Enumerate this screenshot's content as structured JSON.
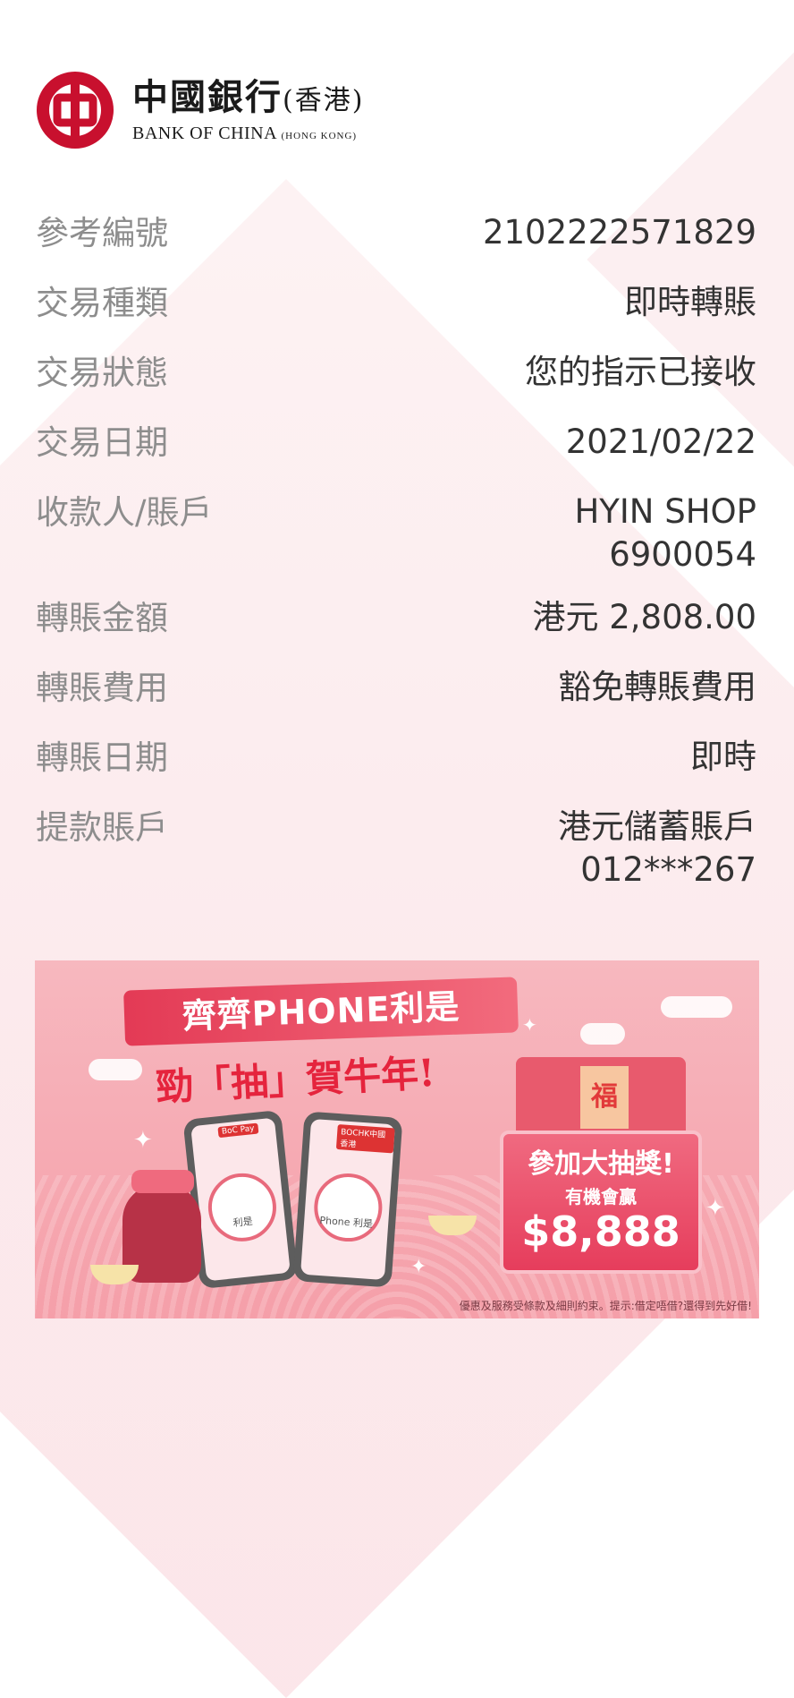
{
  "header": {
    "logo_cn": "中國銀行",
    "logo_cn_sub": "(香港)",
    "logo_en": "BANK OF CHINA",
    "logo_en_sub": "(HONG KONG)",
    "brand_color": "#c8102e"
  },
  "details": [
    {
      "label": "參考編號",
      "value": "2102222571829"
    },
    {
      "label": "交易種類",
      "value": "即時轉賬"
    },
    {
      "label": "交易狀態",
      "value": "您的指示已接收"
    },
    {
      "label": "交易日期",
      "value": "2021/02/22"
    },
    {
      "label": "收款人/賬戶",
      "value": "HYIN SHOP",
      "value2": "6900054"
    },
    {
      "label": "轉賬金額",
      "value": "港元 2,808.00"
    },
    {
      "label": "轉賬費用",
      "value": "豁免轉賬費用"
    },
    {
      "label": "轉賬日期",
      "value": "即時"
    },
    {
      "label": "提款賬戶",
      "value": "港元儲蓄賬戶",
      "value2": "012***267"
    }
  ],
  "banner": {
    "title": "齊齊PHONE利是",
    "slogan": "勁「抽」賀牛年!",
    "phone1_tag": "BoC Pay",
    "phone1_label": "利是",
    "phone2_tag": "BOCHK中國香港",
    "phone2_label": "Phone 利是",
    "envelope_char": "福",
    "prize_line1": "參加大抽獎!",
    "prize_line2": "有機會贏",
    "prize_amount": "$8,888",
    "disclaimer": "優惠及服務受條款及細則約束。提示:借定唔借?還得到先好借!"
  }
}
